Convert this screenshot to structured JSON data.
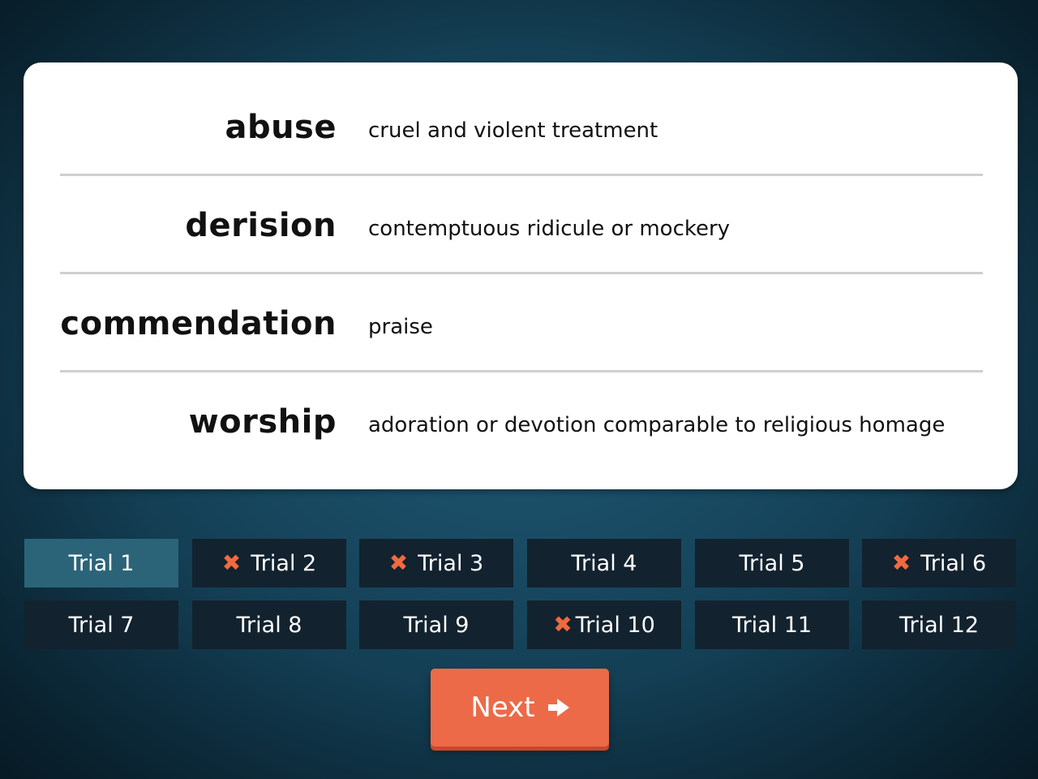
{
  "card": {
    "rows": [
      {
        "term": "abuse",
        "definition": "cruel and violent treatment"
      },
      {
        "term": "derision",
        "definition": "contemptuous ridicule or mockery"
      },
      {
        "term": "commendation",
        "definition": "praise"
      },
      {
        "term": "worship",
        "definition": "adoration or devotion comparable to religious homage"
      }
    ]
  },
  "trials": [
    {
      "label": "Trial 1",
      "active": true,
      "wrong": false
    },
    {
      "label": "Trial 2",
      "active": false,
      "wrong": true
    },
    {
      "label": "Trial 3",
      "active": false,
      "wrong": true
    },
    {
      "label": "Trial 4",
      "active": false,
      "wrong": false
    },
    {
      "label": "Trial 5",
      "active": false,
      "wrong": false
    },
    {
      "label": "Trial 6",
      "active": false,
      "wrong": true
    },
    {
      "label": "Trial 7",
      "active": false,
      "wrong": false
    },
    {
      "label": "Trial 8",
      "active": false,
      "wrong": false
    },
    {
      "label": "Trial 9",
      "active": false,
      "wrong": false
    },
    {
      "label": "Trial 10",
      "active": false,
      "wrong": true
    },
    {
      "label": "Trial 11",
      "active": false,
      "wrong": false
    },
    {
      "label": "Trial 12",
      "active": false,
      "wrong": false
    }
  ],
  "wrong_mark": "✖",
  "next_button": {
    "label": "Next",
    "icon": "arrow-right-icon"
  },
  "colors": {
    "background": "#17445a",
    "card": "#ffffff",
    "trial_tile": "#13222f",
    "trial_active": "#2b6478",
    "wrong_mark": "#ef6a3e",
    "next_button": "#ec6a48"
  }
}
